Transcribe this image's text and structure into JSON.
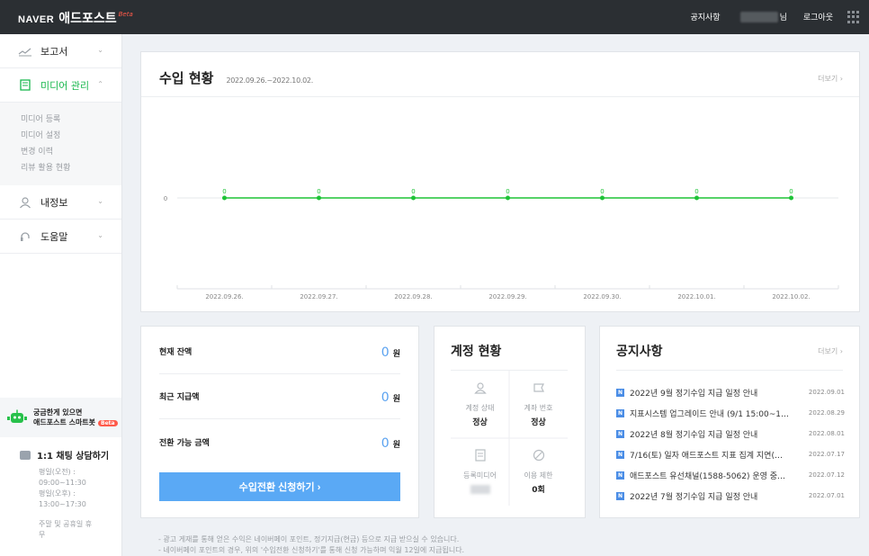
{
  "topbar": {
    "brand": "NAVER",
    "app_name": "애드포스트",
    "beta": "Beta",
    "nav": [
      "공지사항",
      "님",
      "로그아웃"
    ]
  },
  "sidebar": {
    "items": [
      {
        "label": "보고서",
        "icon": "chart-line-icon"
      },
      {
        "label": "미디어 관리",
        "icon": "media-icon",
        "active": true
      },
      {
        "label": "내정보",
        "icon": "user-icon"
      },
      {
        "label": "도움말",
        "icon": "headset-icon"
      }
    ],
    "submenu": [
      "미디어 등록",
      "미디어 설정",
      "변경 이력",
      "리뷰 활용 현황"
    ],
    "chatbot": {
      "line1": "궁금한게 있으면",
      "line2": "애드포스트 스마트봇",
      "badge": "Beta"
    },
    "chat": {
      "title": "1:1 채팅 상담하기",
      "hours": [
        "평일(오전) :",
        "09:00~11:30",
        "평일(오후) :",
        "13:00~17:30"
      ],
      "closed": [
        "주말 및 공휴일 휴",
        "무"
      ]
    }
  },
  "income": {
    "title": "수입 현황",
    "range": "2022.09.26.~2022.10.02.",
    "more": "더보기",
    "y_label": "0"
  },
  "chart_data": {
    "type": "line",
    "x": [
      "2022.09.26.",
      "2022.09.27.",
      "2022.09.28.",
      "2022.09.29.",
      "2022.09.30.",
      "2022.10.01.",
      "2022.10.02."
    ],
    "series": [
      {
        "values": [
          0,
          0,
          0,
          0,
          0,
          0,
          0
        ]
      }
    ],
    "yticks": [
      "0"
    ],
    "color": "#1ec337",
    "grid": true
  },
  "balance": {
    "rows": [
      {
        "label": "현재 잔액",
        "value": "0",
        "unit": "원"
      },
      {
        "label": "최근 지급액",
        "value": "0",
        "unit": "원"
      },
      {
        "label": "전환 가능 금액",
        "value": "0",
        "unit": "원"
      }
    ],
    "button": "수입전환 신청하기 ›"
  },
  "account": {
    "title": "계정 현황",
    "cells": [
      {
        "label": "계정 상태",
        "value": "정상",
        "icon": "person-icon"
      },
      {
        "label": "계좌 번호",
        "value": "정상",
        "icon": "account-icon"
      },
      {
        "label": "등록미디어",
        "value": "",
        "icon": "document-icon"
      },
      {
        "label": "이용 제한",
        "value": "0회",
        "icon": "block-icon"
      }
    ]
  },
  "notice": {
    "title": "공지사항",
    "more": "더보기",
    "badge": "N",
    "items": [
      {
        "text": "2022년 9월 정기수입 지급 일정 안내",
        "date": "2022.09.01"
      },
      {
        "text": "지표시스템 업그레이드 안내 (9/1 15:00~1…",
        "date": "2022.08.29"
      },
      {
        "text": "2022년 8월 정기수입 지급 일정 안내",
        "date": "2022.08.01"
      },
      {
        "text": "7/16(토) 일자 애드포스트 지표 집계 지연(…",
        "date": "2022.07.17"
      },
      {
        "text": "애드포스트 유선채널(1588-5062) 운영 중…",
        "date": "2022.07.12"
      },
      {
        "text": "2022년 7월 정기수입 지급 일정 안내",
        "date": "2022.07.01"
      }
    ]
  },
  "footnotes": [
    "- 광고 게재를 통해 얻은 수익은 네이버페이 포인트, 정기지급(현금) 등으로 지급 받으실 수 있습니다.",
    "- 네이버페이 포인트의 경우, 위의 '수입전환 신청하기'를 통해 신청 가능하며 익월 12일에 지급됩니다."
  ]
}
